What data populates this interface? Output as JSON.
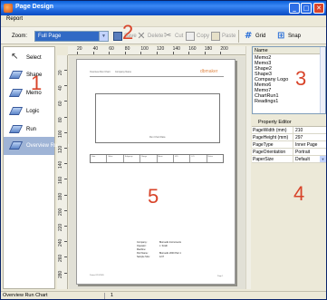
{
  "window": {
    "title": "Page Design",
    "controls": {
      "minimize": "_",
      "maximize": "□",
      "close": "✕"
    }
  },
  "menu": {
    "items": [
      "Report"
    ]
  },
  "toolbar": {
    "zoom_label": "Zoom:",
    "zoom_value": "Full Page",
    "save_label": "Save",
    "delete_label": "Delete",
    "cut_label": "Cut",
    "copy_label": "Copy",
    "paste_label": "Paste",
    "grid_label": "Grid",
    "snap_label": "Snap"
  },
  "toolbox": {
    "items": [
      {
        "label": "Select",
        "icon": "pointer-icon"
      },
      {
        "label": "Shape",
        "icon": "shape-icon"
      },
      {
        "label": "Memo",
        "icon": "memo-icon"
      },
      {
        "label": "Logic",
        "icon": "logic-icon"
      },
      {
        "label": "Run",
        "icon": "run-icon"
      },
      {
        "label": "Overview Run Chart",
        "icon": "chart-icon"
      }
    ]
  },
  "ruler": {
    "h_labels": [
      "20",
      "40",
      "60",
      "80",
      "100",
      "120",
      "140",
      "160",
      "180",
      "200"
    ],
    "v_labels": [
      "20",
      "40",
      "60",
      "80",
      "100",
      "120",
      "140",
      "160",
      "180",
      "200",
      "220",
      "240",
      "260",
      "280"
    ]
  },
  "page": {
    "header_left": "Overview Run Chart",
    "header_mid": "Company Name",
    "logo_text": "dbmaker",
    "chart_caption": "Run Chart Data",
    "table_cells": [
      "Date",
      "Value",
      "Subgroup",
      "Range",
      "Mean",
      "UCL",
      "LCL",
      "Notes"
    ],
    "footer_rows": [
      {
        "k": "Company:",
        "v": "Biomedix Instruments"
      },
      {
        "k": "Operator:",
        "v": "J. Smith"
      },
      {
        "k": "Machine:",
        "v": ""
      },
      {
        "k": "Part Name:",
        "v": "Biomedix 2000 Part 1"
      },
      {
        "k": "Sample Size:",
        "v": "12 P"
      }
    ],
    "bottom_left": "Printed 12/1/2005",
    "bottom_right": "Page 1"
  },
  "objects": {
    "header": "Name",
    "items": [
      "Memo2",
      "Memo3",
      "Shape2",
      "Shape3",
      "Company Logo",
      "Memo6",
      "Memo7",
      "ChartRun1",
      "Readings1"
    ]
  },
  "property_editor": {
    "title": "Property Editor",
    "rows": [
      {
        "key": "PageWidth (mm)",
        "value": "210",
        "dropdown": false
      },
      {
        "key": "PageHeight (mm)",
        "value": "297",
        "dropdown": false
      },
      {
        "key": "PageType",
        "value": "Inner Page",
        "dropdown": false
      },
      {
        "key": "PageOrientation",
        "value": "Portrait",
        "dropdown": false
      },
      {
        "key": "PaperSize",
        "value": "Default",
        "dropdown": true
      }
    ]
  },
  "annotations": {
    "n1": "1",
    "n2": "2",
    "n3": "3",
    "n4": "4",
    "n5": "5"
  },
  "status": {
    "left": "Overview Run Chart",
    "right": "1"
  },
  "colors": {
    "accent": "#316ac5",
    "annotation": "#d8442a",
    "titlebar": "#0a5fd8"
  }
}
